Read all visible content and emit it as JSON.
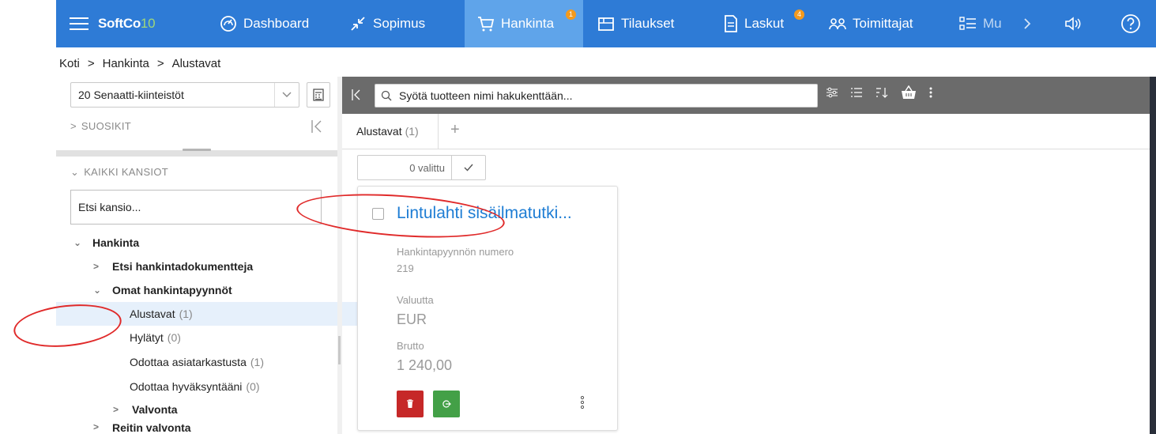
{
  "nav": {
    "brand_main": "SoftCo",
    "brand_ten": "10",
    "dashboard": "Dashboard",
    "sopimus": "Sopimus",
    "hankinta": "Hankinta",
    "hankinta_badge": "1",
    "tilaukset": "Tilaukset",
    "laskut": "Laskut",
    "laskut_badge": "4",
    "toimittajat": "Toimittajat",
    "more": "Mu",
    "active_color": "#5fa4ea",
    "bar_color": "#2e7bd6"
  },
  "breadcrumb": {
    "home": "Koti",
    "sep": ">",
    "level1": "Hankinta",
    "level2": "Alustavat"
  },
  "left": {
    "org_select": "20 Senaatti-kiinteistöt",
    "favourites": "SUOSIKIT",
    "all_folders": "KAIKKI KANSIOT",
    "folder_search_placeholder": "Etsi kansio...",
    "tree": [
      {
        "label": "Hankinta",
        "count": ""
      },
      {
        "label": "Etsi hankintadokumentteja",
        "count": ""
      },
      {
        "label": "Omat hankintapyynnöt",
        "count": ""
      },
      {
        "label": "Alustavat",
        "count": "(1)"
      },
      {
        "label": "Hylätyt",
        "count": "(0)"
      },
      {
        "label": "Odottaa asiatarkastusta",
        "count": "(1)"
      },
      {
        "label": "Odottaa hyväksyntääni",
        "count": "(0)"
      },
      {
        "label": "Valvonta",
        "count": ""
      },
      {
        "label": "Reitin valvonta",
        "count": ""
      }
    ]
  },
  "toolbar": {
    "search_placeholder": "Syötä tuotteen nimi hakukenttään..."
  },
  "tabs": {
    "active_label": "Alustavat",
    "active_count": "(1)",
    "add": "+"
  },
  "selection": {
    "label": "0 valittu"
  },
  "card": {
    "title": "Lintulahti sisäilmatutki...",
    "number_label": "Hankintapyynnön numero",
    "number_value": "219",
    "currency_label": "Valuutta",
    "currency_value": "EUR",
    "gross_label": "Brutto",
    "gross_value": "1 240,00",
    "delete_color": "#c62828",
    "go_color": "#43a047"
  }
}
